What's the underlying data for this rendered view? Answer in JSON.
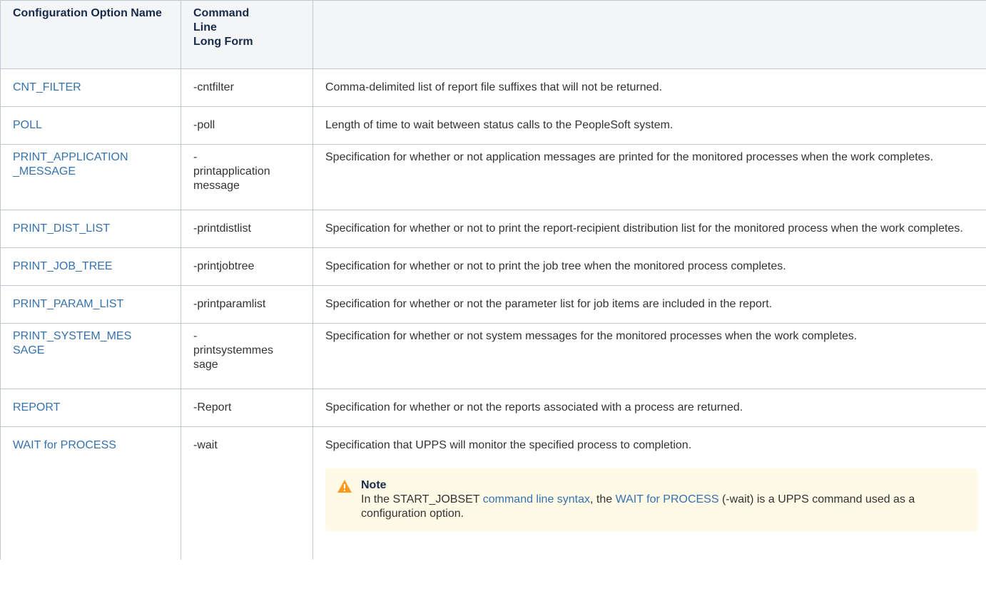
{
  "headers": {
    "col1": "Configuration Option Name",
    "col2_line1": "Command",
    "col2_line2": "Line",
    "col2_line3": "Long Form",
    "col3": ""
  },
  "rows": [
    {
      "name": "CNT_FILTER",
      "cmd": "-cntfilter",
      "desc": "Comma-delimited list of report file suffixes that will not be returned."
    },
    {
      "name": "POLL",
      "cmd": "-poll",
      "desc": "Length of time to wait between status calls to the PeopleSoft system."
    },
    {
      "name_l1": "PRINT_APPLICATION",
      "name_l2": "_MESSAGE",
      "cmd_l1": "-",
      "cmd_l2": "printapplication",
      "cmd_l3": "message",
      "desc": "Specification for whether or not application messages are printed for the monitored processes when the work completes."
    },
    {
      "name": "PRINT_DIST_LIST",
      "cmd": "-printdistlist",
      "desc": "Specification for whether or not to print the report-recipient distribution list for the monitored process when the work completes."
    },
    {
      "name": "PRINT_JOB_TREE",
      "cmd": "-printjobtree",
      "desc": "Specification for whether or not to print the job tree when the monitored process completes."
    },
    {
      "name": "PRINT_PARAM_LIST",
      "cmd": "-printparamlist",
      "desc": "Specification for whether or not the parameter list for job items are included in the report."
    },
    {
      "name_l1": "PRINT_SYSTEM_MES",
      "name_l2": "SAGE",
      "cmd_l1": "-",
      "cmd_l2": "printsystemmes",
      "cmd_l3": "sage",
      "desc": "Specification for whether or not system messages for the monitored processes when the work completes."
    },
    {
      "name": "REPORT",
      "cmd": "-Report",
      "desc": "Specification for whether or not the reports associated with a process are returned."
    },
    {
      "name": "WAIT for PROCESS",
      "cmd": "-wait",
      "desc": "Specification that UPPS will monitor the specified process to completion."
    }
  ],
  "note": {
    "title": "Note",
    "text_before": "In the START_JOBSET ",
    "link1": "command line syntax",
    "text_mid": ", the ",
    "link2": "WAIT for PROCESS",
    "text_after": " (-wait) is a UPPS command used as a configuration option.",
    "icon": "warning-icon",
    "icon_color": "#ff991f"
  },
  "colors": {
    "link": "#3572b0",
    "header_bg": "#f4f5f7",
    "border": "#c1c7d0",
    "note_bg": "#fffae6"
  }
}
